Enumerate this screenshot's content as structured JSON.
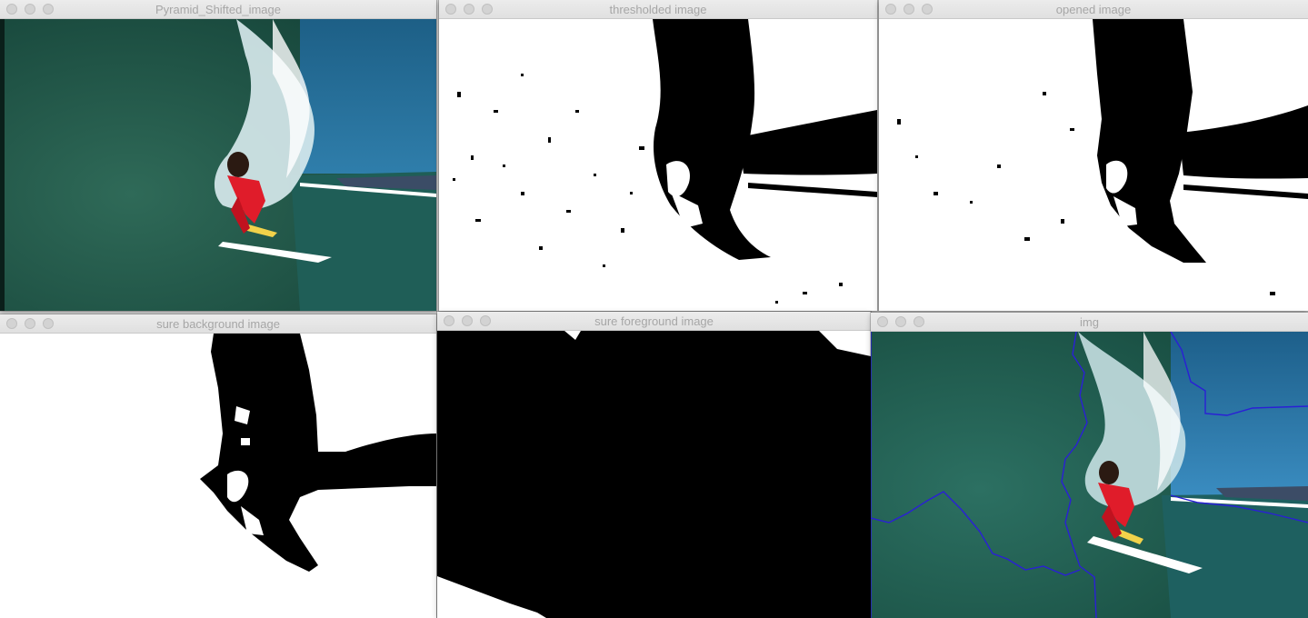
{
  "windows": {
    "w1": {
      "title": "Pyramid_Shifted_image"
    },
    "w2": {
      "title": "thresholded image"
    },
    "w3": {
      "title": "opened image"
    },
    "w4": {
      "title": "sure background image"
    },
    "w5": {
      "title": "sure foreground image"
    },
    "w6": {
      "title": "img"
    }
  },
  "icons": {
    "close": "close-icon",
    "minimize": "minimize-icon",
    "zoom": "zoom-icon"
  },
  "colors": {
    "ocean_dark": "#1a4a3c",
    "ocean_mid": "#2a6c5e",
    "sky": "#2f79a8",
    "spray": "#e8f3f6",
    "wetsuit": "#e01c2a",
    "board": "#f2d24a",
    "contour": "#2a1fd6"
  }
}
